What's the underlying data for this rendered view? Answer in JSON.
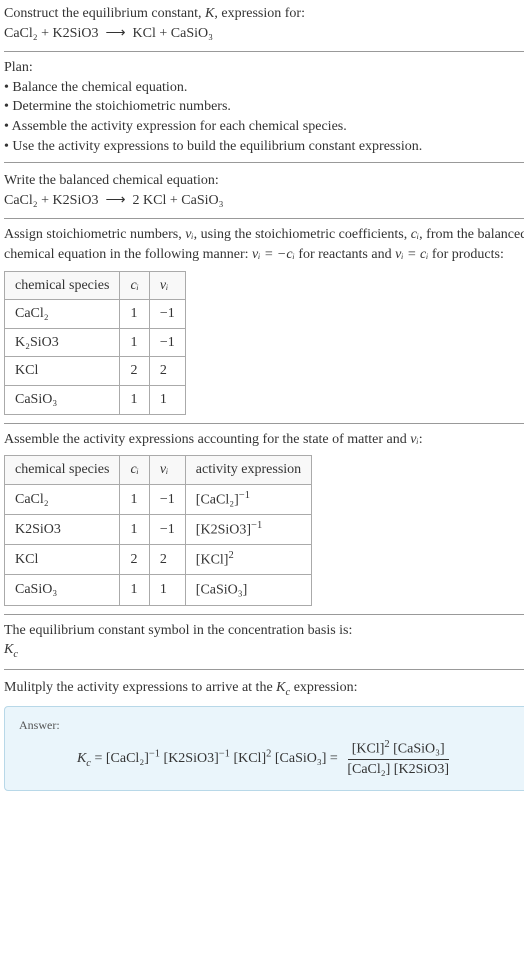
{
  "intro": {
    "line1": "Construct the equilibrium constant, ",
    "line1_k": "K",
    "line1_end": ", expression for:",
    "equation_reactants": "CaCl₂ + K2SiO3",
    "equation_arrow": "⟶",
    "equation_products": "KCl + CaSiO₃"
  },
  "plan": {
    "header": "Plan:",
    "b1": "• Balance the chemical equation.",
    "b2": "• Determine the stoichiometric numbers.",
    "b3": "• Assemble the activity expression for each chemical species.",
    "b4": "• Use the activity expressions to build the equilibrium constant expression."
  },
  "balanced": {
    "header": "Write the balanced chemical equation:",
    "reactants": "CaCl₂ + K2SiO3",
    "arrow": "⟶",
    "products": "2 KCl + CaSiO₃"
  },
  "stoich": {
    "intro_a": "Assign stoichiometric numbers, ",
    "intro_b": ", using the stoichiometric coefficients, ",
    "intro_c": ", from the balanced chemical equation in the following manner: ",
    "intro_d": " for reactants and ",
    "intro_e": " for products:",
    "nu": "νᵢ",
    "ci": "cᵢ",
    "eq1": "νᵢ = −cᵢ",
    "eq2": "νᵢ = cᵢ",
    "headers": {
      "h1": "chemical species",
      "h2": "cᵢ",
      "h3": "νᵢ"
    },
    "rows": [
      {
        "sp": "CaCl₂",
        "c": "1",
        "n": "−1"
      },
      {
        "sp": "K₂SiO3",
        "c": "1",
        "n": "−1"
      },
      {
        "sp": "KCl",
        "c": "2",
        "n": "2"
      },
      {
        "sp": "CaSiO₃",
        "c": "1",
        "n": "1"
      }
    ]
  },
  "activity": {
    "intro_a": "Assemble the activity expressions accounting for the state of matter and ",
    "intro_b": ":",
    "nu": "νᵢ",
    "headers": {
      "h1": "chemical species",
      "h2": "cᵢ",
      "h3": "νᵢ",
      "h4": "activity expression"
    },
    "rows": [
      {
        "sp": "CaCl₂",
        "c": "1",
        "n": "−1",
        "ae_base": "[CaCl₂]",
        "ae_exp": "−1"
      },
      {
        "sp": "K2SiO3",
        "c": "1",
        "n": "−1",
        "ae_base": "[K2SiO3]",
        "ae_exp": "−1"
      },
      {
        "sp": "KCl",
        "c": "2",
        "n": "2",
        "ae_base": "[KCl]",
        "ae_exp": "2"
      },
      {
        "sp": "CaSiO₃",
        "c": "1",
        "n": "1",
        "ae_base": "[CaSiO₃]",
        "ae_exp": ""
      }
    ]
  },
  "symbol": {
    "text": "The equilibrium constant symbol in the concentration basis is:",
    "kc": "K",
    "kc_sub": "c"
  },
  "multiply": {
    "text_a": "Mulitply the activity expressions to arrive at the ",
    "text_b": " expression:",
    "kc": "K",
    "kc_sub": "c"
  },
  "answer": {
    "label": "Answer:",
    "kc": "K",
    "kc_sub": "c",
    "eq_sign": " = ",
    "t1": "[CaCl₂]",
    "t1e": "−1",
    "t2": "[K2SiO3]",
    "t2e": "−1",
    "t3": "[KCl]",
    "t3e": "2",
    "t4": "[CaSiO₃]",
    "num1": "[KCl]",
    "num1e": "2",
    "num2": "[CaSiO₃]",
    "den1": "[CaCl₂]",
    "den2": "[K2SiO3]"
  }
}
